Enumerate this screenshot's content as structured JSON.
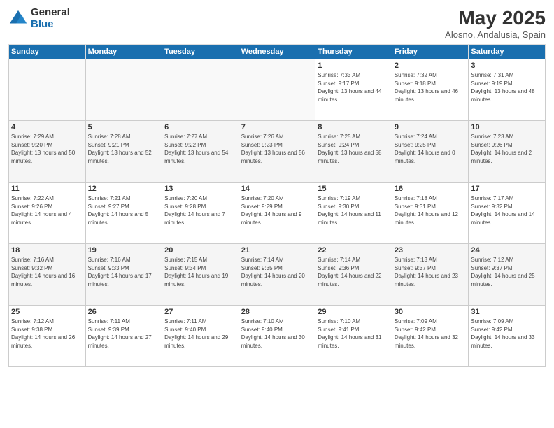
{
  "header": {
    "logo_general": "General",
    "logo_blue": "Blue",
    "month_title": "May 2025",
    "location": "Alosno, Andalusia, Spain"
  },
  "days_of_week": [
    "Sunday",
    "Monday",
    "Tuesday",
    "Wednesday",
    "Thursday",
    "Friday",
    "Saturday"
  ],
  "weeks": [
    {
      "cells": [
        {
          "day": "",
          "empty": true
        },
        {
          "day": "",
          "empty": true
        },
        {
          "day": "",
          "empty": true
        },
        {
          "day": "",
          "empty": true
        },
        {
          "day": "1",
          "sunrise": "7:33 AM",
          "sunset": "9:17 PM",
          "daylight": "13 hours and 44 minutes."
        },
        {
          "day": "2",
          "sunrise": "7:32 AM",
          "sunset": "9:18 PM",
          "daylight": "13 hours and 46 minutes."
        },
        {
          "day": "3",
          "sunrise": "7:31 AM",
          "sunset": "9:19 PM",
          "daylight": "13 hours and 48 minutes."
        }
      ]
    },
    {
      "cells": [
        {
          "day": "4",
          "sunrise": "7:29 AM",
          "sunset": "9:20 PM",
          "daylight": "13 hours and 50 minutes."
        },
        {
          "day": "5",
          "sunrise": "7:28 AM",
          "sunset": "9:21 PM",
          "daylight": "13 hours and 52 minutes."
        },
        {
          "day": "6",
          "sunrise": "7:27 AM",
          "sunset": "9:22 PM",
          "daylight": "13 hours and 54 minutes."
        },
        {
          "day": "7",
          "sunrise": "7:26 AM",
          "sunset": "9:23 PM",
          "daylight": "13 hours and 56 minutes."
        },
        {
          "day": "8",
          "sunrise": "7:25 AM",
          "sunset": "9:24 PM",
          "daylight": "13 hours and 58 minutes."
        },
        {
          "day": "9",
          "sunrise": "7:24 AM",
          "sunset": "9:25 PM",
          "daylight": "14 hours and 0 minutes."
        },
        {
          "day": "10",
          "sunrise": "7:23 AM",
          "sunset": "9:26 PM",
          "daylight": "14 hours and 2 minutes."
        }
      ]
    },
    {
      "cells": [
        {
          "day": "11",
          "sunrise": "7:22 AM",
          "sunset": "9:26 PM",
          "daylight": "14 hours and 4 minutes."
        },
        {
          "day": "12",
          "sunrise": "7:21 AM",
          "sunset": "9:27 PM",
          "daylight": "14 hours and 5 minutes."
        },
        {
          "day": "13",
          "sunrise": "7:20 AM",
          "sunset": "9:28 PM",
          "daylight": "14 hours and 7 minutes."
        },
        {
          "day": "14",
          "sunrise": "7:20 AM",
          "sunset": "9:29 PM",
          "daylight": "14 hours and 9 minutes."
        },
        {
          "day": "15",
          "sunrise": "7:19 AM",
          "sunset": "9:30 PM",
          "daylight": "14 hours and 11 minutes."
        },
        {
          "day": "16",
          "sunrise": "7:18 AM",
          "sunset": "9:31 PM",
          "daylight": "14 hours and 12 minutes."
        },
        {
          "day": "17",
          "sunrise": "7:17 AM",
          "sunset": "9:32 PM",
          "daylight": "14 hours and 14 minutes."
        }
      ]
    },
    {
      "cells": [
        {
          "day": "18",
          "sunrise": "7:16 AM",
          "sunset": "9:32 PM",
          "daylight": "14 hours and 16 minutes."
        },
        {
          "day": "19",
          "sunrise": "7:16 AM",
          "sunset": "9:33 PM",
          "daylight": "14 hours and 17 minutes."
        },
        {
          "day": "20",
          "sunrise": "7:15 AM",
          "sunset": "9:34 PM",
          "daylight": "14 hours and 19 minutes."
        },
        {
          "day": "21",
          "sunrise": "7:14 AM",
          "sunset": "9:35 PM",
          "daylight": "14 hours and 20 minutes."
        },
        {
          "day": "22",
          "sunrise": "7:14 AM",
          "sunset": "9:36 PM",
          "daylight": "14 hours and 22 minutes."
        },
        {
          "day": "23",
          "sunrise": "7:13 AM",
          "sunset": "9:37 PM",
          "daylight": "14 hours and 23 minutes."
        },
        {
          "day": "24",
          "sunrise": "7:12 AM",
          "sunset": "9:37 PM",
          "daylight": "14 hours and 25 minutes."
        }
      ]
    },
    {
      "cells": [
        {
          "day": "25",
          "sunrise": "7:12 AM",
          "sunset": "9:38 PM",
          "daylight": "14 hours and 26 minutes."
        },
        {
          "day": "26",
          "sunrise": "7:11 AM",
          "sunset": "9:39 PM",
          "daylight": "14 hours and 27 minutes."
        },
        {
          "day": "27",
          "sunrise": "7:11 AM",
          "sunset": "9:40 PM",
          "daylight": "14 hours and 29 minutes."
        },
        {
          "day": "28",
          "sunrise": "7:10 AM",
          "sunset": "9:40 PM",
          "daylight": "14 hours and 30 minutes."
        },
        {
          "day": "29",
          "sunrise": "7:10 AM",
          "sunset": "9:41 PM",
          "daylight": "14 hours and 31 minutes."
        },
        {
          "day": "30",
          "sunrise": "7:09 AM",
          "sunset": "9:42 PM",
          "daylight": "14 hours and 32 minutes."
        },
        {
          "day": "31",
          "sunrise": "7:09 AM",
          "sunset": "9:42 PM",
          "daylight": "14 hours and 33 minutes."
        }
      ]
    }
  ]
}
